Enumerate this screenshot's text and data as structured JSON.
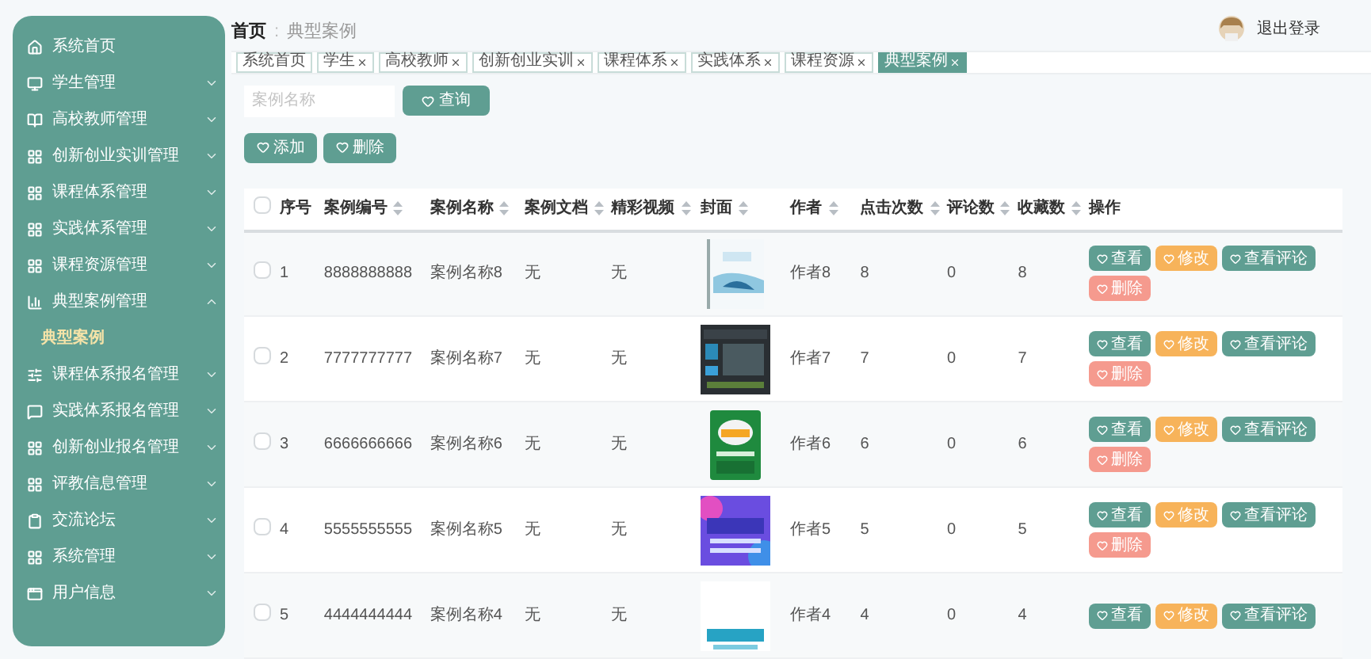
{
  "sidebar": {
    "items": [
      {
        "label": "系统首页"
      },
      {
        "label": "学生管理",
        "expanded": false
      },
      {
        "label": "高校教师管理",
        "expanded": false
      },
      {
        "label": "创新创业实训管理",
        "expanded": false
      },
      {
        "label": "课程体系管理",
        "expanded": false
      },
      {
        "label": "实践体系管理",
        "expanded": false
      },
      {
        "label": "课程资源管理",
        "expanded": false
      },
      {
        "label": "典型案例管理",
        "expanded": true,
        "children": [
          {
            "label": "典型案例",
            "selected": true
          }
        ]
      },
      {
        "label": "课程体系报名管理",
        "expanded": false
      },
      {
        "label": "实践体系报名管理",
        "expanded": false
      },
      {
        "label": "创新创业报名管理",
        "expanded": false
      },
      {
        "label": "评教信息管理",
        "expanded": false
      },
      {
        "label": "交流论坛",
        "expanded": false
      },
      {
        "label": "系统管理",
        "expanded": false
      },
      {
        "label": "用户信息",
        "expanded": false
      }
    ]
  },
  "breadcrumb": {
    "home": "首页",
    "separator": ":",
    "current": "典型案例"
  },
  "user": {
    "logout": "退出登录"
  },
  "tags": [
    {
      "label": "系统首页",
      "closable": false,
      "selected": false
    },
    {
      "label": "学生",
      "closable": true,
      "selected": false
    },
    {
      "label": "高校教师",
      "closable": true,
      "selected": false
    },
    {
      "label": "创新创业实训",
      "closable": true,
      "selected": false
    },
    {
      "label": "课程体系",
      "closable": true,
      "selected": false
    },
    {
      "label": "实践体系",
      "closable": true,
      "selected": false
    },
    {
      "label": "课程资源",
      "closable": true,
      "selected": false
    },
    {
      "label": "典型案例",
      "closable": true,
      "selected": true
    }
  ],
  "search": {
    "placeholder": "案例名称",
    "button": "查询"
  },
  "toolbar": [
    "添加",
    "删除"
  ],
  "table": {
    "header_checked": false,
    "columns": [
      {
        "label": "序号",
        "sortable": false
      },
      {
        "label": "案例编号",
        "sortable": true
      },
      {
        "label": "案例名称",
        "sortable": true
      },
      {
        "label": "案例文档",
        "sortable": true
      },
      {
        "label": "精彩视频",
        "sortable": true
      },
      {
        "label": "封面",
        "sortable": true
      },
      {
        "label": "作者",
        "sortable": true
      },
      {
        "label": "点击次数",
        "sortable": true
      },
      {
        "label": "评论数",
        "sortable": true
      },
      {
        "label": "收藏数",
        "sortable": true
      },
      {
        "label": "操作",
        "sortable": false
      }
    ],
    "rows": [
      {
        "checked": false,
        "no": "1",
        "code": "8888888888",
        "name": "案例名称8",
        "doc": "无",
        "video": "无",
        "author": "作者8",
        "clicks": "8",
        "comments": "0",
        "favorites": "8",
        "actions": [
          {
            "kind": "view",
            "label": "查看"
          },
          {
            "kind": "edit",
            "label": "修改"
          },
          {
            "kind": "view",
            "label": "查看评论"
          },
          {
            "kind": "delete",
            "label": "删除"
          }
        ]
      },
      {
        "checked": false,
        "no": "2",
        "code": "7777777777",
        "name": "案例名称7",
        "doc": "无",
        "video": "无",
        "author": "作者7",
        "clicks": "7",
        "comments": "0",
        "favorites": "7",
        "actions": [
          {
            "kind": "view",
            "label": "查看"
          },
          {
            "kind": "edit",
            "label": "修改"
          },
          {
            "kind": "view",
            "label": "查看评论"
          },
          {
            "kind": "delete",
            "label": "删除"
          }
        ]
      },
      {
        "checked": false,
        "no": "3",
        "code": "6666666666",
        "name": "案例名称6",
        "doc": "无",
        "video": "无",
        "author": "作者6",
        "clicks": "6",
        "comments": "0",
        "favorites": "6",
        "actions": [
          {
            "kind": "view",
            "label": "查看"
          },
          {
            "kind": "edit",
            "label": "修改"
          },
          {
            "kind": "view",
            "label": "查看评论"
          },
          {
            "kind": "delete",
            "label": "删除"
          }
        ]
      },
      {
        "checked": false,
        "no": "4",
        "code": "5555555555",
        "name": "案例名称5",
        "doc": "无",
        "video": "无",
        "author": "作者5",
        "clicks": "5",
        "comments": "0",
        "favorites": "5",
        "actions": [
          {
            "kind": "view",
            "label": "查看"
          },
          {
            "kind": "edit",
            "label": "修改"
          },
          {
            "kind": "view",
            "label": "查看评论"
          },
          {
            "kind": "delete",
            "label": "删除"
          }
        ]
      },
      {
        "checked": false,
        "no": "5",
        "code": "4444444444",
        "name": "案例名称4",
        "doc": "无",
        "video": "无",
        "author": "作者4",
        "clicks": "4",
        "comments": "0",
        "favorites": "4",
        "actions": [
          {
            "kind": "view",
            "label": "查看"
          },
          {
            "kind": "edit",
            "label": "修改"
          },
          {
            "kind": "view",
            "label": "查看评论"
          }
        ]
      }
    ]
  }
}
